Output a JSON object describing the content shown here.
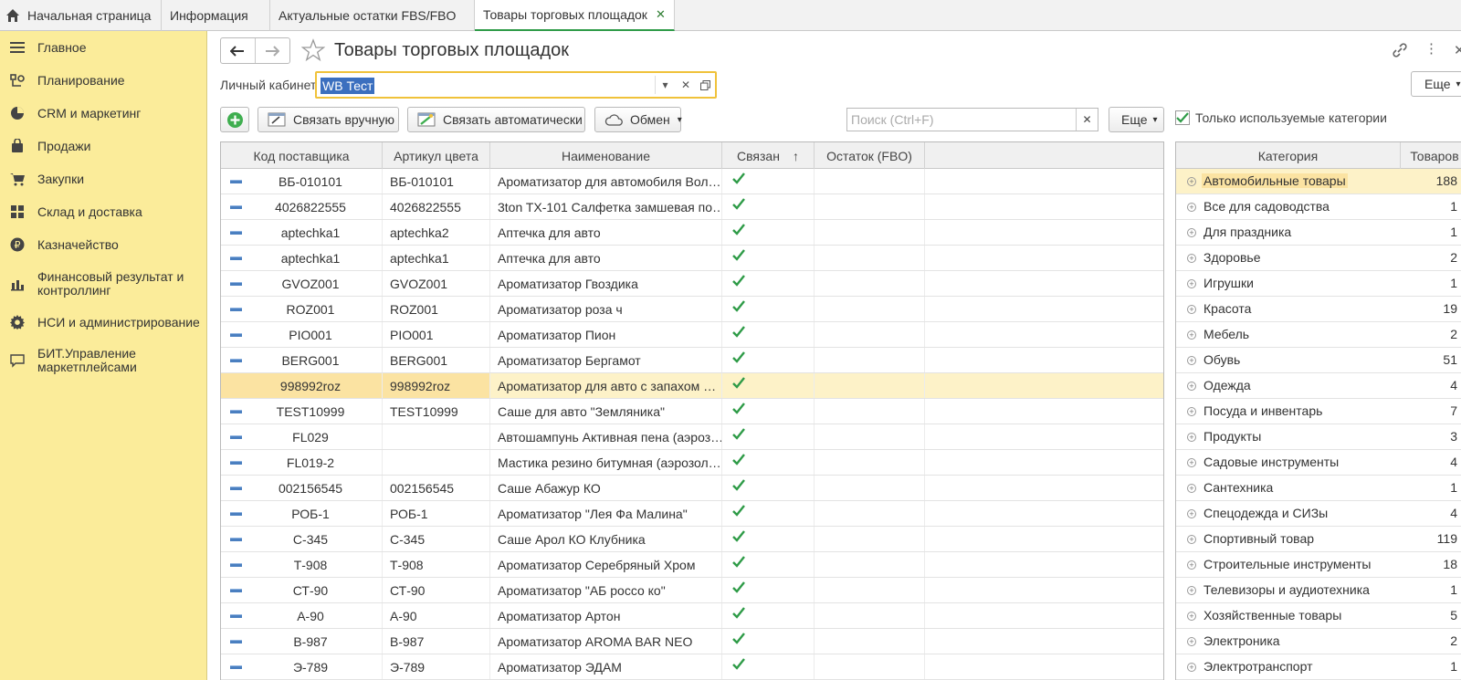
{
  "tabs": [
    {
      "label": "Начальная страница",
      "icon": "home-icon"
    },
    {
      "label": "Информация"
    },
    {
      "label": "Актуальные остатки FBS/FBO"
    },
    {
      "label": "Товары торговых площадок",
      "active": true
    }
  ],
  "sidebar": {
    "items": [
      {
        "label": "Главное",
        "icon": "menu-icon"
      },
      {
        "label": "Планирование",
        "icon": "planning-icon"
      },
      {
        "label": "CRM и маркетинг",
        "icon": "pie-chart-icon"
      },
      {
        "label": "Продажи",
        "icon": "bag-icon"
      },
      {
        "label": "Закупки",
        "icon": "cart-icon"
      },
      {
        "label": "Склад и доставка",
        "icon": "warehouse-icon"
      },
      {
        "label": "Казначейство",
        "icon": "ruble-icon"
      },
      {
        "label": "Финансовый результат и контроллинг",
        "icon": "bar-chart-icon"
      },
      {
        "label": "НСИ и администрирование",
        "icon": "gear-icon"
      },
      {
        "label": "БИТ.Управление маркетплейсами",
        "icon": "chat-icon"
      }
    ]
  },
  "header": {
    "title": "Товары торговых площадок",
    "more_label": "Еще"
  },
  "account": {
    "label": "Личный кабинет:",
    "value": "WB Тест"
  },
  "toolbar": {
    "link_manual": "Связать вручную",
    "link_auto": "Связать автоматически",
    "exchange": "Обмен",
    "search_placeholder": "Поиск (Ctrl+F)",
    "more": "Еще",
    "only_used_label": "Только используемые категории",
    "only_used_checked": true
  },
  "grid": {
    "columns": [
      "Код поставщика",
      "Артикул цвета",
      "Наименование",
      "Связан",
      "Остаток (FBO)"
    ],
    "selected_row": 8,
    "rows": [
      {
        "code": "ВБ-010101",
        "article": "ВБ-010101",
        "name": "Ароматизатор для автомобиля Вол…",
        "linked": true
      },
      {
        "code": "4026822555",
        "article": "4026822555",
        "name": "3ton TX-101 Салфетка замшевая по…",
        "linked": true
      },
      {
        "code": "aptechka1",
        "article": "aptechka2",
        "name": "Аптечка для авто",
        "linked": true
      },
      {
        "code": "aptechka1",
        "article": "aptechka1",
        "name": "Аптечка для авто",
        "linked": true
      },
      {
        "code": "GVOZ001",
        "article": "GVOZ001",
        "name": "Ароматизатор Гвоздика",
        "linked": true
      },
      {
        "code": "ROZ001",
        "article": "ROZ001",
        "name": "Ароматизатор роза ч",
        "linked": true
      },
      {
        "code": "PIO001",
        "article": "PIO001",
        "name": "Ароматизатор Пион",
        "linked": true
      },
      {
        "code": "BERG001",
        "article": "BERG001",
        "name": "Ароматизатор Бергамот",
        "linked": true
      },
      {
        "code": "998992roz",
        "article": "998992roz",
        "name": "Ароматизатор для авто с запахом …",
        "linked": true
      },
      {
        "code": "TEST10999",
        "article": "TEST10999",
        "name": "Саше для авто \"Земляника\"",
        "linked": true
      },
      {
        "code": "FL029",
        "article": "",
        "name": "Автошампунь Активная пена (аэроз…",
        "linked": true
      },
      {
        "code": "FL019-2",
        "article": "",
        "name": "Мастика резино битумная (аэрозол…",
        "linked": true
      },
      {
        "code": "002156545",
        "article": "002156545",
        "name": "Саше Абажур КО",
        "linked": true
      },
      {
        "code": "РОБ-1",
        "article": "РОБ-1",
        "name": "Ароматизатор \"Лея Фа Малина\"",
        "linked": true
      },
      {
        "code": "С-345",
        "article": "С-345",
        "name": "Саше Арол КО Клубника",
        "linked": true
      },
      {
        "code": "Т-908",
        "article": "Т-908",
        "name": "Ароматизатор Серебряный Хром",
        "linked": true
      },
      {
        "code": "СТ-90",
        "article": "СТ-90",
        "name": "Ароматизатор \"АБ россо ко\"",
        "linked": true
      },
      {
        "code": "А-90",
        "article": "А-90",
        "name": "Ароматизатор Артон",
        "linked": true
      },
      {
        "code": "В-987",
        "article": "В-987",
        "name": "Ароматизатор AROMA BAR NEO",
        "linked": true
      },
      {
        "code": "Э-789",
        "article": "Э-789",
        "name": "Ароматизатор ЭДАМ",
        "linked": true
      }
    ]
  },
  "categories": {
    "columns": [
      "Категория",
      "Товаров"
    ],
    "selected_row": 0,
    "rows": [
      {
        "name": "Автомобильные товары",
        "count": "188"
      },
      {
        "name": "Все для садоводства",
        "count": "1"
      },
      {
        "name": "Для праздника",
        "count": "1"
      },
      {
        "name": "Здоровье",
        "count": "2"
      },
      {
        "name": "Игрушки",
        "count": "1"
      },
      {
        "name": "Красота",
        "count": "19"
      },
      {
        "name": "Мебель",
        "count": "2"
      },
      {
        "name": "Обувь",
        "count": "51"
      },
      {
        "name": "Одежда",
        "count": "4"
      },
      {
        "name": "Посуда и инвентарь",
        "count": "7"
      },
      {
        "name": "Продукты",
        "count": "3"
      },
      {
        "name": "Садовые инструменты",
        "count": "4"
      },
      {
        "name": "Сантехника",
        "count": "1"
      },
      {
        "name": "Спецодежда и СИЗы",
        "count": "4"
      },
      {
        "name": "Спортивный товар",
        "count": "119"
      },
      {
        "name": "Строительные инструменты",
        "count": "18"
      },
      {
        "name": "Телевизоры и аудиотехника",
        "count": "1"
      },
      {
        "name": "Хозяйственные товары",
        "count": "5"
      },
      {
        "name": "Электроника",
        "count": "2"
      },
      {
        "name": "Электротранспорт",
        "count": "1"
      }
    ]
  }
}
